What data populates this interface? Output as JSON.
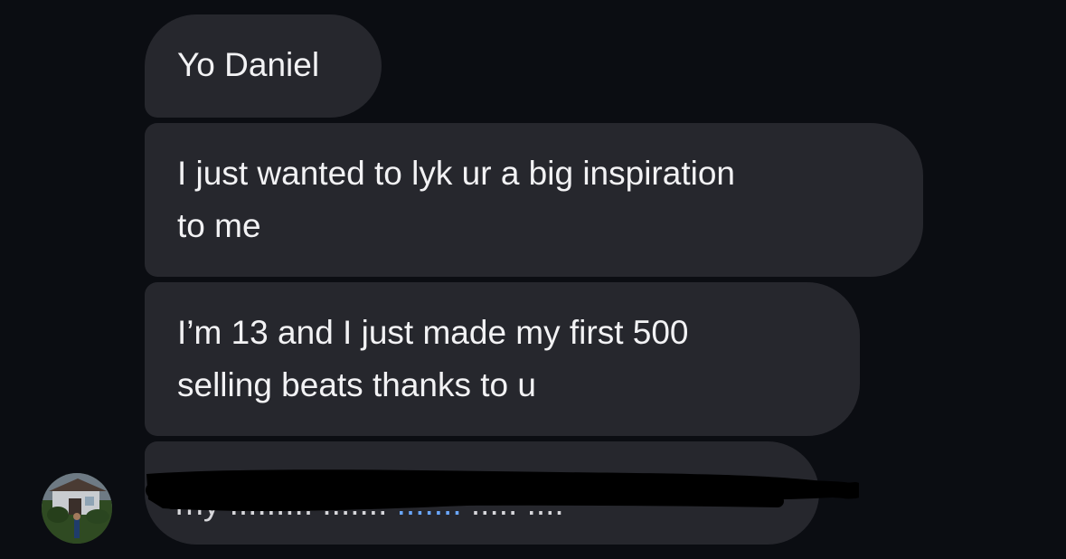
{
  "messages": [
    {
      "text": "Yo Daniel"
    },
    {
      "text": "I just wanted to lyk ur a big inspiration\nto me"
    },
    {
      "text": "I’m 13 and I just made my first 500\nselling beats thanks to u"
    }
  ],
  "colors": {
    "background": "#0b0d12",
    "bubble": "#26272d",
    "text": "#f2f2f4",
    "link": "#6aa7ff",
    "redaction": "#000000"
  },
  "icons": {
    "avatar": "profile-photo"
  }
}
